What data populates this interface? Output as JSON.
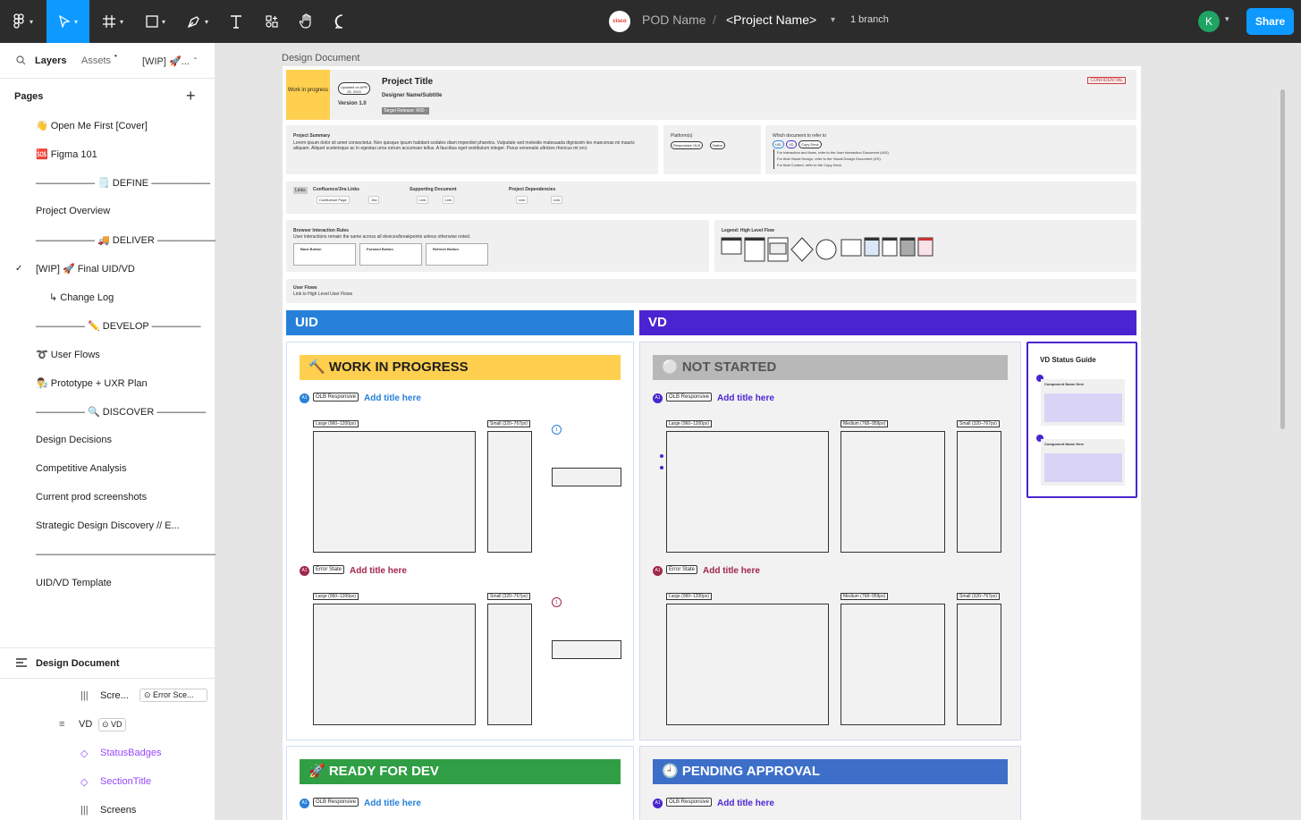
{
  "toolbar": {
    "brand_label": "cisco",
    "pod_name": "POD Name",
    "separator": "/",
    "project_name": "<Project Name>",
    "branch": "1 branch",
    "avatar_initial": "K",
    "share": "Share"
  },
  "sidebar": {
    "tabs": {
      "layers": "Layers",
      "assets": "Assets",
      "page": "[WIP] 🚀..."
    },
    "pages_heading": "Pages",
    "pages": [
      "👋 Open Me First [Cover]",
      "🆘 Figma 101",
      "—————— 🗒️ DEFINE ——————",
      "Project Overview",
      "—————— 🚚 DELIVER ——————",
      "[WIP] 🚀 Final UID/VD",
      "↳ Change Log",
      "————— ✏️ DEVELOP —————",
      "➰ User Flows",
      "👨‍🔬 Prototype + UXR Plan",
      "————— 🔍 DISCOVER —————",
      "Design Decisions",
      "Competitive Analysis",
      "Current prod screenshots",
      "Strategic Design Discovery // E...",
      "———————————————————",
      "UID/VD Template"
    ],
    "layers_heading": "Design Document",
    "layers": [
      {
        "label": "Scre...",
        "tag": "Error Sce..."
      },
      {
        "label": "VD",
        "tag": "VD"
      },
      {
        "label": "StatusBadges",
        "tag": ""
      },
      {
        "label": "SectionTitle",
        "tag": ""
      },
      {
        "label": "Screens",
        "tag": ""
      }
    ]
  },
  "canvas": {
    "frame_label": "Design Document",
    "header": {
      "wip": "Work in progress",
      "updated": "Updated on APR 25, 2023",
      "version": "Version 1.0",
      "title": "Project Title",
      "subtitle": "Designer Name/Subtitle",
      "release": "Target Release: R00 -",
      "confidential": "CONFIDENTIAL"
    },
    "summary": {
      "heading": "Project Summary",
      "text": "Lorem ipsum dolor sit amet consectetur. Non quisque ipsum habitant sodales diam imperdiet pharetra. Vulputate sed molestie malesuada dignissim leo maecenas mi mauris aliquam. Aliquet scelerisque ac in egestas urna rutrum accumsan tellus. A faucibus eget vestibulum integer. Purus venenatis ultricies rhoncus mi orci."
    },
    "platforms": {
      "heading": "Platform(s)",
      "items": [
        "Responsive OLB",
        "Native"
      ]
    },
    "which_doc": {
      "heading": "Which document to refer to",
      "chips": [
        "UID",
        "VD",
        "Copy Deck"
      ],
      "lines": [
        "For Interaction and flows, refer to the User Interaction Document (UID).",
        "For final Visual Design, refer to the Visual Design Document (VD).",
        "For final Content, refer to the Copy Deck."
      ]
    },
    "links": {
      "label": "Links",
      "confluence": "Confluence/Jira Links",
      "confluence_items": [
        "Confluence Page",
        "Jira"
      ],
      "supporting": "Supporting Document",
      "supporting_items": [
        "Link",
        "Link"
      ],
      "deps": "Project Dependencies",
      "deps_items": [
        "Link",
        "Link"
      ]
    },
    "browser": {
      "heading": "Browser Interaction Rules",
      "sub": "User interactions remain the same across all devices/breakpoints unless otherwise noted.",
      "cards": [
        "Back Button",
        "Forward Button",
        "Refresh Button"
      ]
    },
    "legend": {
      "heading": "Legend: High Level Flow"
    },
    "user_flows": {
      "heading": "User Flows",
      "sub": "Link to High Level User Flows"
    },
    "uid": "UID",
    "vd": "VD",
    "status_wip": "🔨 WORK IN PROGRESS",
    "status_not_started": "⚪ NOT STARTED",
    "status_ready": "🚀 READY FOR DEV",
    "status_pending": "🕘 PENDING APPROVAL",
    "badge_a1": "A1",
    "olb": "OLB Responsive",
    "error": "Error State",
    "add_title": "Add title here",
    "large": "Large (960–1200px)",
    "medium": "Medium (768–959px)",
    "small": "Small (320–767px)",
    "guide": "VD Status Guide",
    "component_name": "Component Name Here"
  },
  "colors": {
    "uid": "#2680d9",
    "vd": "#4a24d0",
    "wip": "#ffcf4f",
    "ready": "#2f9e44",
    "pending": "#3d6fc9",
    "not_started": "#b8b8b8",
    "share": "#0d99ff"
  }
}
